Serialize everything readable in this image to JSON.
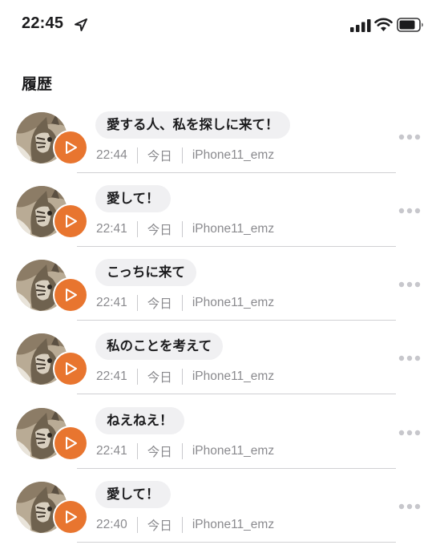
{
  "status_bar": {
    "time": "22:45",
    "icons": [
      "location-arrow-icon",
      "cellular-signal-icon",
      "wifi-icon",
      "battery-icon"
    ]
  },
  "section": {
    "title": "履歴"
  },
  "colors": {
    "accent": "#e8752f",
    "bubble_bg": "#f0f0f2",
    "meta_text": "#8a8a8e"
  },
  "history": [
    {
      "message": "愛する人、私を探しに来て！",
      "time": "22:44",
      "day": "今日",
      "device": "iPhone11_emz"
    },
    {
      "message": "愛して！",
      "time": "22:41",
      "day": "今日",
      "device": "iPhone11_emz"
    },
    {
      "message": "こっちに来て",
      "time": "22:41",
      "day": "今日",
      "device": "iPhone11_emz"
    },
    {
      "message": "私のことを考えて",
      "time": "22:41",
      "day": "今日",
      "device": "iPhone11_emz"
    },
    {
      "message": "ねえねえ！",
      "time": "22:41",
      "day": "今日",
      "device": "iPhone11_emz"
    },
    {
      "message": "愛して！",
      "time": "22:40",
      "day": "今日",
      "device": "iPhone11_emz"
    }
  ]
}
